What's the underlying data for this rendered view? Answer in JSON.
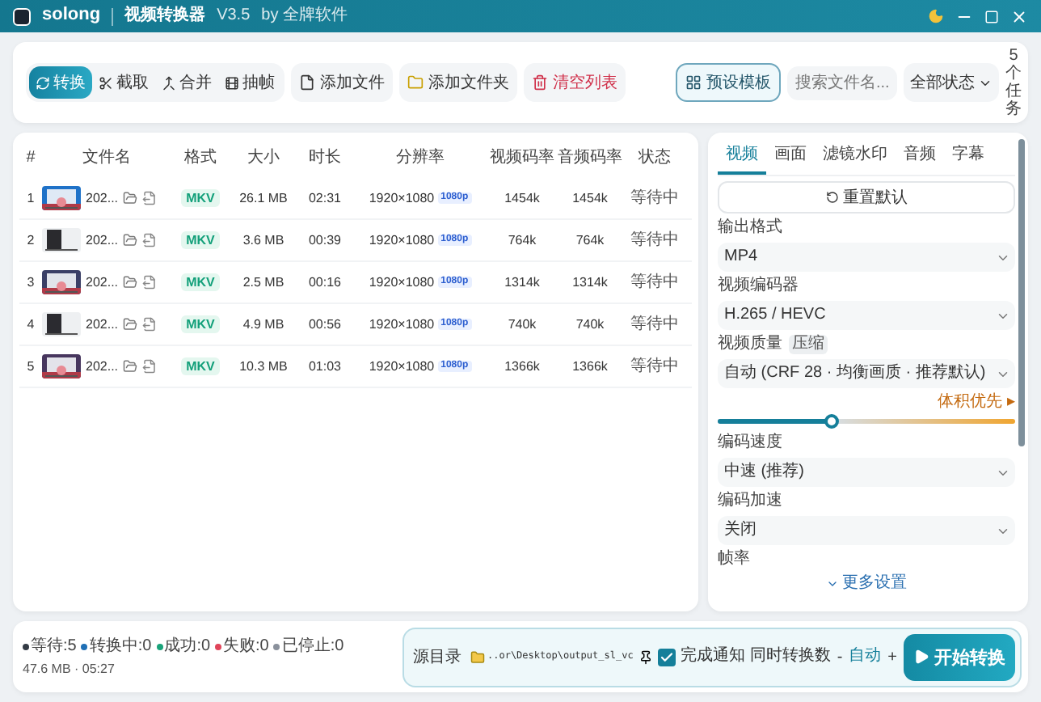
{
  "window": {
    "brand": "solong",
    "title": "视频转换器",
    "version": "V3.5",
    "author": "by 全牌软件"
  },
  "toolbar": {
    "modes": [
      {
        "label": "转换",
        "kind": "convert",
        "selected": true
      },
      {
        "label": "截取",
        "kind": "cut",
        "selected": false
      },
      {
        "label": "合并",
        "kind": "merge",
        "selected": false
      },
      {
        "label": "抽帧",
        "kind": "frames",
        "selected": false
      }
    ],
    "actions": [
      {
        "label": "添加文件",
        "kind": "file"
      },
      {
        "label": "添加文件夹",
        "kind": "folder"
      },
      {
        "label": "清空列表",
        "kind": "clear"
      }
    ],
    "preset": "预设模板",
    "search": {
      "placeholder": "搜索文件名..."
    },
    "filter": "全部状态",
    "task_count": "5个任务"
  },
  "table": {
    "columns": [
      "#",
      "文件名",
      "格式",
      "大小",
      "时长",
      "分辨率",
      "视频码率",
      "音频码率",
      "状态"
    ],
    "rows": [
      {
        "index": "1",
        "name": "202...",
        "format": "MKV",
        "size": "26.1 MB",
        "duration": "02:31",
        "resolution": "1920×1080",
        "quality": "1080p",
        "video_bitrate": "1454k",
        "audio_bitrate": "1454k",
        "status": "等待中"
      },
      {
        "index": "2",
        "name": "202...",
        "format": "MKV",
        "size": "3.6 MB",
        "duration": "00:39",
        "resolution": "1920×1080",
        "quality": "1080p",
        "video_bitrate": "764k",
        "audio_bitrate": "764k",
        "status": "等待中"
      },
      {
        "index": "3",
        "name": "202...",
        "format": "MKV",
        "size": "2.5 MB",
        "duration": "00:16",
        "resolution": "1920×1080",
        "quality": "1080p",
        "video_bitrate": "1314k",
        "audio_bitrate": "1314k",
        "status": "等待中"
      },
      {
        "index": "4",
        "name": "202...",
        "format": "MKV",
        "size": "4.9 MB",
        "duration": "00:56",
        "resolution": "1920×1080",
        "quality": "1080p",
        "video_bitrate": "740k",
        "audio_bitrate": "740k",
        "status": "等待中"
      },
      {
        "index": "5",
        "name": "202...",
        "format": "MKV",
        "size": "10.3 MB",
        "duration": "01:03",
        "resolution": "1920×1080",
        "quality": "1080p",
        "video_bitrate": "1366k",
        "audio_bitrate": "1366k",
        "status": "等待中"
      }
    ]
  },
  "settings": {
    "tabs": [
      {
        "label": "视频",
        "selected": true
      },
      {
        "label": "画面",
        "selected": false
      },
      {
        "label": "滤镜水印",
        "selected": false
      },
      {
        "label": "音频",
        "selected": false
      },
      {
        "label": "字幕",
        "selected": false
      }
    ],
    "reset": "重置默认",
    "fields": [
      {
        "kind": "select",
        "label": "输出格式",
        "value": "MP4"
      },
      {
        "kind": "select",
        "label": "视频编码器",
        "value": "H.265 / HEVC"
      },
      {
        "kind": "select",
        "label": "视频质量",
        "badge": "压缩",
        "value": "自动 (CRF 28 · 均衡画质 · 推荐默认)"
      },
      {
        "kind": "slider",
        "level": 0.38,
        "right_label": "体积优先 ▸"
      },
      {
        "kind": "select",
        "label": "编码速度",
        "value": "中速 (推荐)"
      },
      {
        "kind": "select",
        "label": "编码加速",
        "value": "关闭"
      },
      {
        "kind": "label",
        "label": "帧率"
      }
    ],
    "more": "更多设置"
  },
  "status_bar": {
    "counts": [
      {
        "label": "等待:5",
        "color": "#333b45"
      },
      {
        "label": "转换中:0",
        "color": "#1f6fb5"
      },
      {
        "label": "成功:0",
        "color": "#1aa37a"
      },
      {
        "label": "失败:0",
        "color": "#e0455a"
      },
      {
        "label": "已停止:0",
        "color": "#8a919c"
      }
    ],
    "summary": "47.6 MB · 05:27",
    "source_button": "源目录",
    "output_path": "..or\\Desktop\\output_sl_vc",
    "notify": {
      "label": "完成通知",
      "checked": true
    },
    "concurrency": {
      "label": "同时转换数",
      "minus": "-",
      "value": "自动",
      "plus": "+"
    },
    "start": "开始转换"
  }
}
